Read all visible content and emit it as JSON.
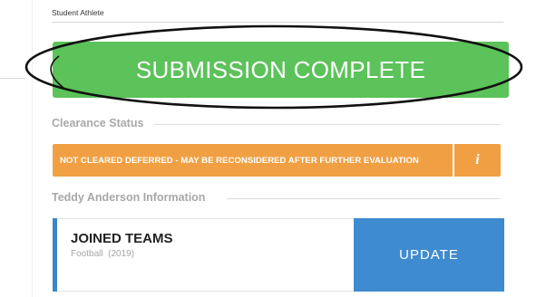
{
  "header": {
    "subtitle": "Student Athlete"
  },
  "banner": {
    "text": "SUBMISSION COMPLETE"
  },
  "clearance": {
    "title": "Clearance Status",
    "status_text": "NOT CLEARED DEFERRED - MAY BE RECONSIDERED AFTER FURTHER EVALUATION",
    "info_glyph": "i"
  },
  "info_section": {
    "title": "Teddy Anderson Information"
  },
  "teams": {
    "title": "JOINED TEAMS",
    "sport": "Football",
    "year": "(2019)",
    "update_label": "UPDATE"
  },
  "colors": {
    "success": "#5cc25a",
    "warning": "#f0a043",
    "primary": "#3f8bd0"
  },
  "icons": {
    "info": "info-icon"
  }
}
